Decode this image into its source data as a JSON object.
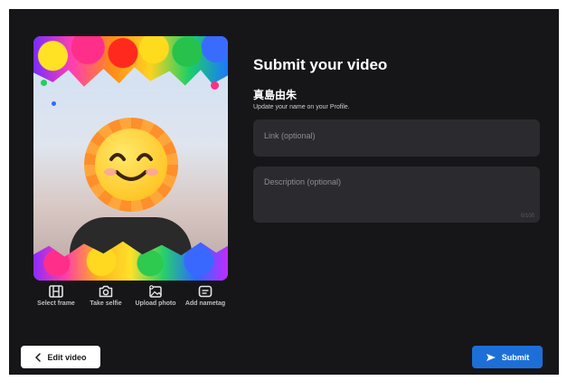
{
  "form": {
    "title": "Submit your video",
    "user_name": "真島由朱",
    "user_hint": "Update your name on your Profile.",
    "link_placeholder": "Link (optional)",
    "description_placeholder": "Description (optional)",
    "description_counter": "0/100"
  },
  "tools": [
    {
      "label": "Select frame",
      "icon": "film-icon"
    },
    {
      "label": "Take selfie",
      "icon": "camera-icon"
    },
    {
      "label": "Upload photo",
      "icon": "image-upload-icon"
    },
    {
      "label": "Add nametag",
      "icon": "nametag-icon"
    }
  ],
  "buttons": {
    "edit_video": "Edit video",
    "submit": "Submit"
  },
  "colors": {
    "background": "#161619",
    "field": "#2b2b2f",
    "accent": "#1d6fd8"
  }
}
